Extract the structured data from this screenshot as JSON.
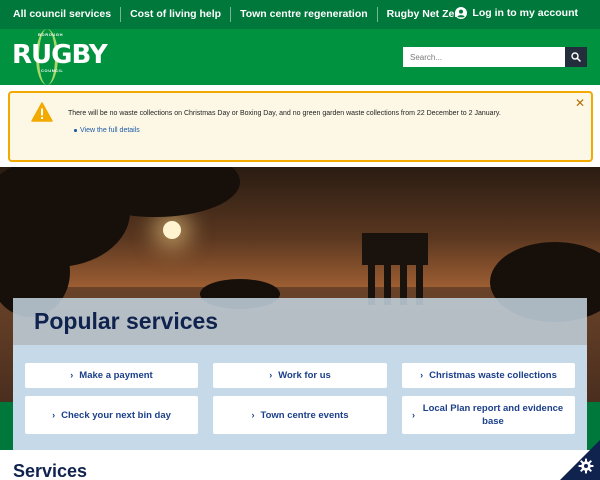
{
  "topnav": {
    "items": [
      "All council services",
      "Cost of living help",
      "Town centre regeneration",
      "Rugby Net Zero"
    ],
    "login_label": "Log in to my account"
  },
  "header": {
    "logo_top": "BOROUGH",
    "logo_word": "RUGBY",
    "logo_bottom": "COUNCIL",
    "search_placeholder": "Search..."
  },
  "alert": {
    "message": "There will be no waste collections on Christmas Day or Boxing Day, and no green garden waste collections from 22 December to 2 January.",
    "link": "View the full details"
  },
  "popular": {
    "title": "Popular services",
    "buttons": [
      "Make a payment",
      "Work for us",
      "Christmas waste collections",
      "Check your next bin day",
      "Town centre events",
      "Local Plan report and evidence base"
    ]
  },
  "services_heading": "Services",
  "colors": {
    "topnav": "#00783c",
    "header": "#00923f",
    "alert_border": "#f2a900",
    "navy": "#10234e",
    "panel": "#c5d9e8"
  }
}
